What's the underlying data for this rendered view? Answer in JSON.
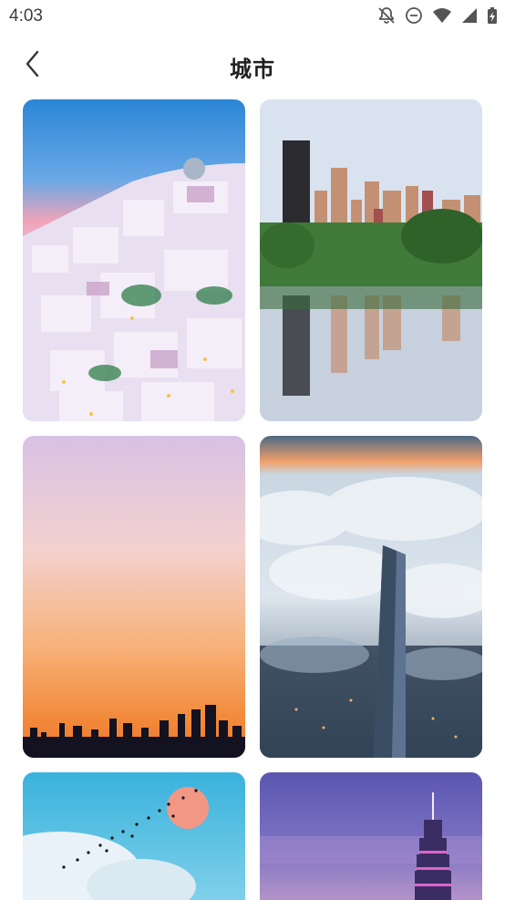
{
  "status_bar": {
    "time": "4:03",
    "icons": [
      "notifications-off-icon",
      "do-not-disturb-icon",
      "wifi-icon",
      "cell-signal-icon",
      "battery-charging-icon"
    ]
  },
  "header": {
    "back_icon": "back-arrow-icon",
    "title": "城市"
  },
  "wallpapers": [
    {
      "id": "santorini",
      "icon": "image"
    },
    {
      "id": "chicago-reflection",
      "icon": "image"
    },
    {
      "id": "sunset-skyline",
      "icon": "image"
    },
    {
      "id": "shanghai-clouds",
      "icon": "image"
    },
    {
      "id": "birds-sun",
      "icon": "image"
    },
    {
      "id": "taipei-101",
      "icon": "image"
    }
  ],
  "colors": {
    "background": "#ffffff",
    "title": "#1f1f1f"
  }
}
